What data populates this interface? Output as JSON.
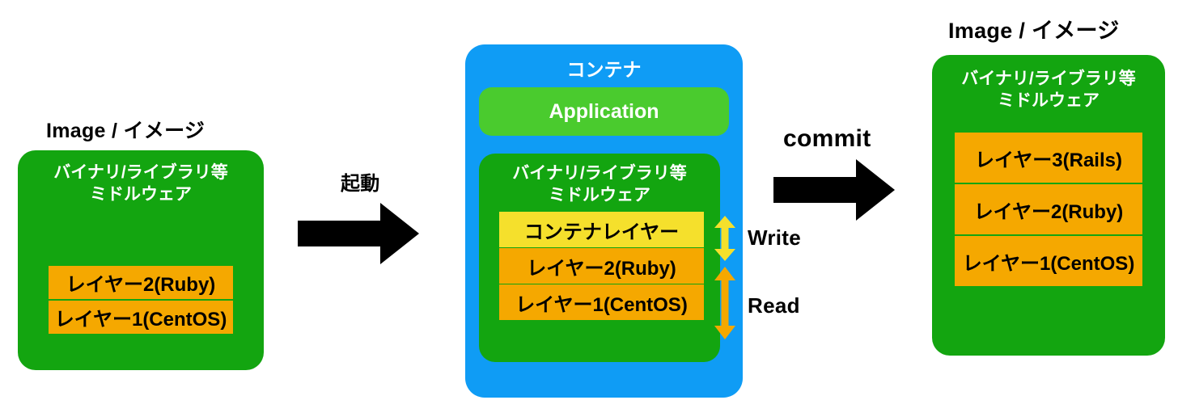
{
  "diagram": {
    "title_implicit": "Docker image / container layer diagram",
    "left_image": {
      "caption": "Image / イメージ",
      "box_title": "バイナリ/ライブラリ等\nミドルウェア",
      "layers": [
        {
          "label": "レイヤー2(Ruby)",
          "color": "#f5a800"
        },
        {
          "label": "レイヤー1(CentOS)",
          "color": "#f5a800"
        }
      ],
      "box_color": "#13a510"
    },
    "startup_arrow": {
      "label": "起動",
      "color": "#000000"
    },
    "container": {
      "title": "コンテナ",
      "box_color": "#0f9cf5",
      "application": {
        "label": "Application",
        "color": "#4acb2e"
      },
      "green_box_title": "バイナリ/ライブラリ等\nミドルウェア",
      "green_box_color": "#13a510",
      "layers": [
        {
          "label": "コンテナレイヤー",
          "color": "#f5e02c"
        },
        {
          "label": "レイヤー2(Ruby)",
          "color": "#f5a800"
        },
        {
          "label": "レイヤー1(CentOS)",
          "color": "#f5a800"
        }
      ],
      "annotations": [
        {
          "label": "Write",
          "arrow_color": "#f5e02c",
          "direction": "bidirectional"
        },
        {
          "label": "Read",
          "arrow_color": "#f5a800",
          "direction": "bidirectional"
        }
      ]
    },
    "commit_arrow": {
      "label": "commit",
      "color": "#000000"
    },
    "right_image": {
      "caption": "Image / イメージ",
      "box_title": "バイナリ/ライブラリ等\nミドルウェア",
      "layers": [
        {
          "label": "レイヤー3(Rails)",
          "color": "#f5a800"
        },
        {
          "label": "レイヤー2(Ruby)",
          "color": "#f5a800"
        },
        {
          "label": "レイヤー1(CentOS)",
          "color": "#f5a800"
        }
      ],
      "box_color": "#13a510"
    }
  }
}
